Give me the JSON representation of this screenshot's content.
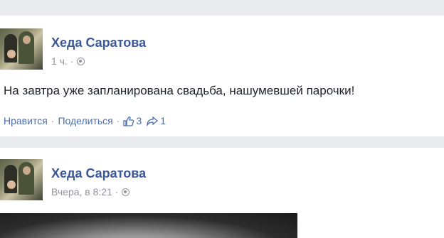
{
  "posts": [
    {
      "author": "Хеда Саратова",
      "time": "1 ч. ·",
      "text": "На завтра уже запланирована свадьба, нашумевшей парочки!",
      "actions": {
        "like_label": "Нравится",
        "share_label": "Поделиться",
        "like_count": "3",
        "share_count": "1"
      }
    },
    {
      "author": "Хеда Саратова",
      "time": "Вчера, в 8:21 ·"
    }
  ],
  "colors": {
    "link": "#3b5998",
    "meta": "#90949c",
    "background": "#e9ebee"
  },
  "icons": [
    "globe-icon",
    "thumbs-up-icon",
    "share-icon"
  ]
}
